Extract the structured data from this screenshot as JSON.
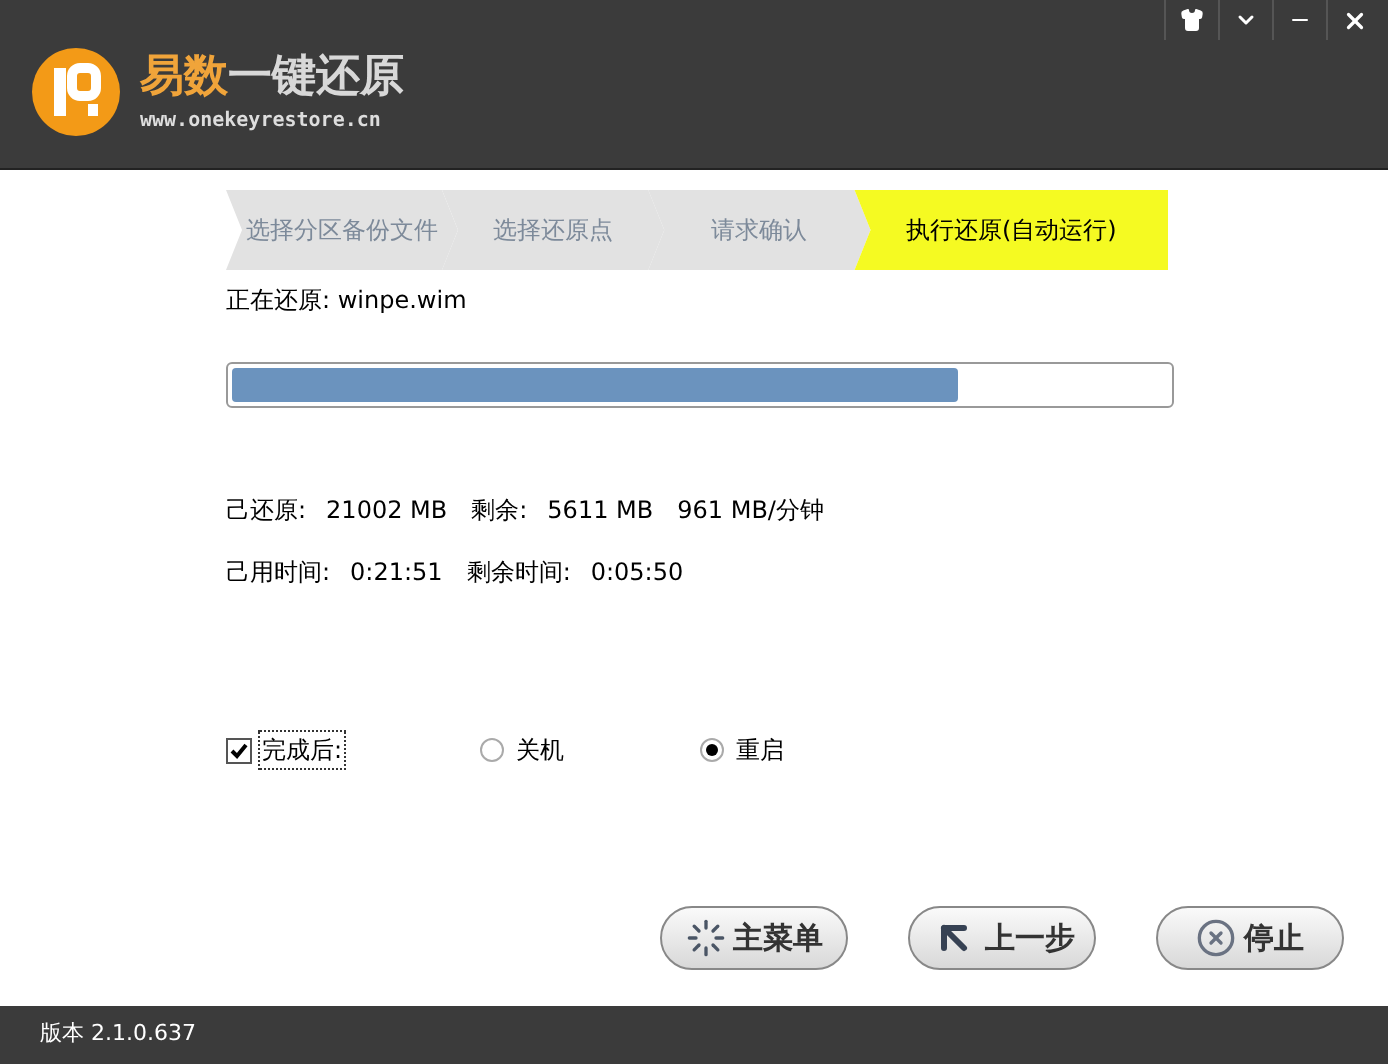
{
  "header": {
    "title_accent": "易数",
    "title_rest": "一键还原",
    "url": "www.onekeyrestore.cn"
  },
  "steps": [
    {
      "label": "选择分区备份文件",
      "selected": false
    },
    {
      "label": "选择还原点",
      "selected": false
    },
    {
      "label": "请求确认",
      "selected": false
    },
    {
      "label": "执行还原(自动运行)",
      "selected": true
    }
  ],
  "status": "正在还原: winpe.wim",
  "progress": {
    "level": 0.775
  },
  "stats": [
    [
      {
        "kind": "label",
        "text": "己还原:"
      },
      {
        "kind": "value",
        "text": "21002 MB"
      },
      {
        "kind": "label",
        "text": "剩余:"
      },
      {
        "kind": "value",
        "text": "5611 MB"
      },
      {
        "kind": "value",
        "text": "961 MB/分钟"
      }
    ],
    [
      {
        "kind": "label",
        "text": "己用时间:"
      },
      {
        "kind": "value",
        "text": "0:21:51"
      },
      {
        "kind": "label",
        "text": "剩余时间:"
      },
      {
        "kind": "value",
        "text": "0:05:50"
      }
    ]
  ],
  "after_done": {
    "label": "完成后:",
    "checked": true
  },
  "options": [
    {
      "label": "关机",
      "selected": false
    },
    {
      "label": "重启",
      "selected": true
    }
  ],
  "buttons": [
    {
      "kind": "menu",
      "label": "主菜单"
    },
    {
      "kind": "back",
      "label": "上一步"
    },
    {
      "kind": "stop",
      "label": "停止"
    }
  ],
  "version": "版本 2.1.0.637"
}
